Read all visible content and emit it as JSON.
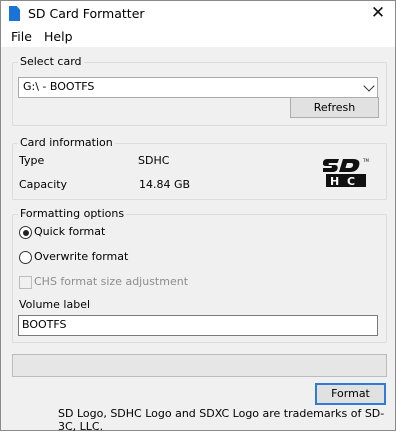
{
  "window": {
    "title": "SD Card Formatter",
    "close_glyph": "✕",
    "app_icon": "sd-card-icon"
  },
  "menu": [
    "File",
    "Help"
  ],
  "select_card": {
    "title": "Select card",
    "selected": "G:\\ - BOOTFS",
    "refresh_label": "Refresh"
  },
  "card_info": {
    "title": "Card information",
    "type_label": "Type",
    "type_value": "SDHC",
    "capacity_label": "Capacity",
    "capacity_value": "14.84 GB",
    "logo": {
      "top": "SD",
      "bottom": "HC"
    }
  },
  "formatting": {
    "title": "Formatting options",
    "quick_label": "Quick format",
    "quick_selected": true,
    "overwrite_label": "Overwrite format",
    "overwrite_selected": false,
    "chs_label": "CHS format size adjustment",
    "chs_checked": false,
    "chs_enabled": false,
    "volume_label_title": "Volume label",
    "volume_label_value": "BOOTFS"
  },
  "progress": {
    "value": 0
  },
  "format_button_label": "Format",
  "footer": "SD Logo, SDHC Logo and SDXC Logo are trademarks of SD-3C, LLC.",
  "colors": {
    "accent": "#2f7bd6",
    "progress": "#06b025",
    "icon": "#1a73d9"
  }
}
